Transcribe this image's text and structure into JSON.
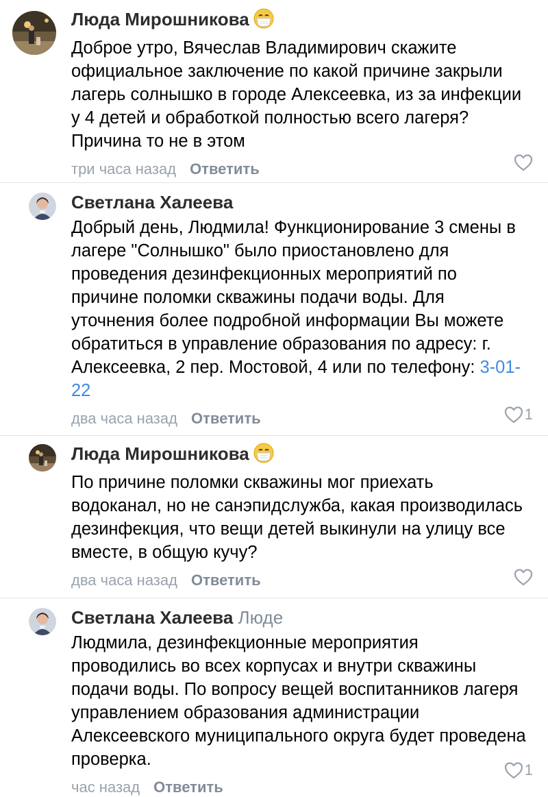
{
  "comments": [
    {
      "author": "Люда Мирошникова",
      "reply_to": "",
      "emoji": "face-with-medical-mask",
      "text": "Доброе утро, Вячеслав Владимирович скажите официальное заключение по какой причине закрыли лагерь солнышко в городе Алексеевка, из за инфекции у 4 детей и обработкой полностью всего лагеря? Причина то не в этом",
      "time": "три часа назад",
      "reply_label": "Ответить",
      "likes": ""
    },
    {
      "author": "Светлана Халеева",
      "reply_to": "",
      "text_before_phone": "Добрый день, Людмила! Функционирование 3 смены в лагере \"Солнышко\" было приостановлено для проведения  дезинфекционных мероприятий по причине поломки скважины подачи воды. Для уточнения более подробной информации Вы можете обратиться в управление образования по адресу: г. Алексеевка, 2 пер. Мостовой, 4 или по телефону: ",
      "phone": "3-01-22",
      "time": "два часа назад",
      "reply_label": "Ответить",
      "likes": "1"
    },
    {
      "author": "Люда Мирошникова",
      "reply_to": "",
      "emoji": "face-with-medical-mask",
      "text": "По причине поломки скважины мог приехать водоканал, но не санэпидслужба, какая производилась дезинфекция, что вещи детей выкинули на улицу все вместе, в общую кучу?",
      "time": "два часа назад",
      "reply_label": "Ответить",
      "likes": ""
    },
    {
      "author": "Светлана Халеева",
      "reply_to": "Люде",
      "text": "Людмила, дезинфекционные мероприятия проводились во всех корпусах и внутри скважины подачи воды. По вопросу вещей воспитанников лагеря управлением образования администрации Алексеевского муниципального округа будет проведена проверка.",
      "time": "час назад",
      "reply_label": "Ответить",
      "likes": "1"
    }
  ],
  "colors": {
    "author": "#2c2d2e",
    "meta": "#99a2ad",
    "reply_button": "#818c99",
    "link": "#3f8ae0",
    "divider": "#e3e4e8"
  }
}
